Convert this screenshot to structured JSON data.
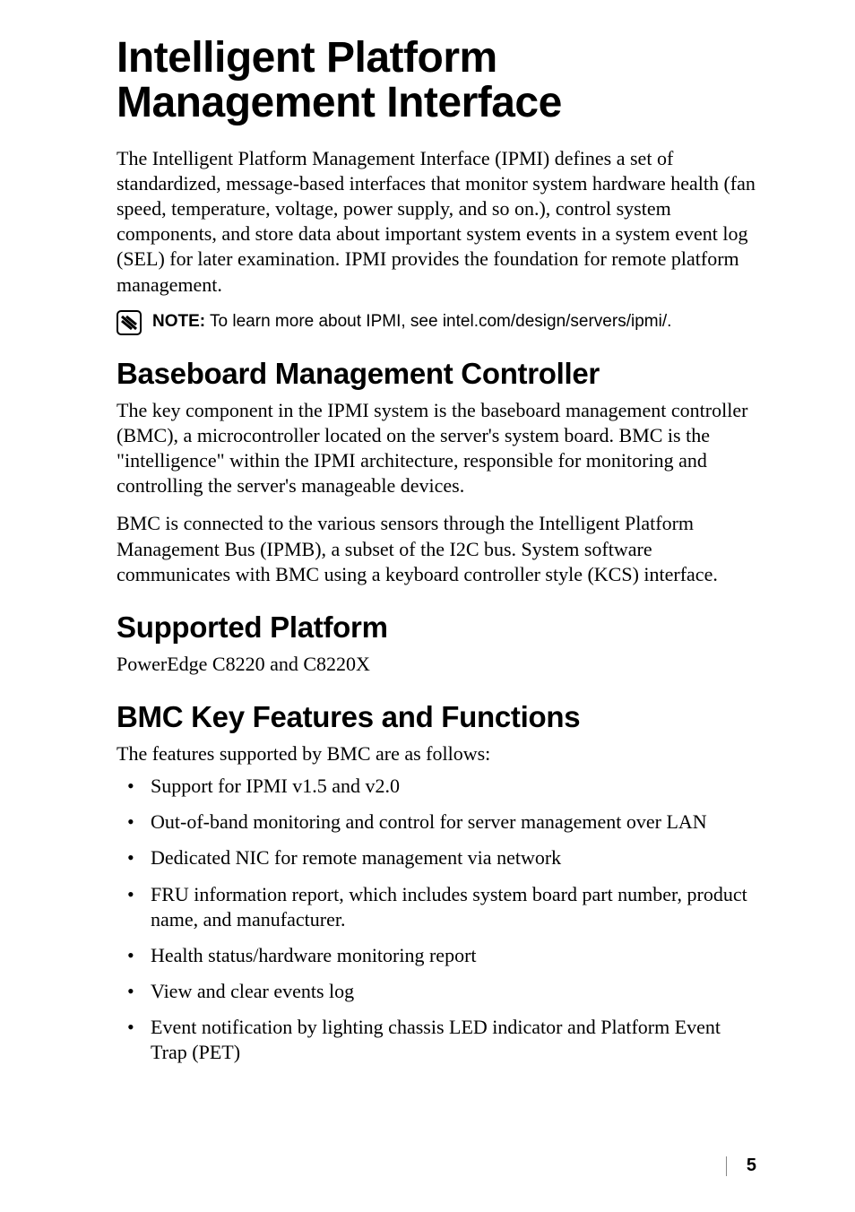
{
  "chapter_title": "Intelligent Platform Management Interface",
  "intro_para": "The Intelligent Platform Management Interface (IPMI) defines a set of standardized, message-based interfaces that monitor system hardware health (fan speed, temperature, voltage, power supply, and so on.), control system components, and store data about important system events in a system event log (SEL) for later examination. IPMI provides the foundation for remote platform management.",
  "note": {
    "label": "NOTE:",
    "text": " To learn more about IPMI, see intel.com/design/servers/ipmi/."
  },
  "sections": {
    "bmc": {
      "heading": "Baseboard Management Controller",
      "para1": "The key component in the IPMI system is the baseboard management controller (BMC), a microcontroller located on the server's system board. BMC is the \"intelligence\" within the IPMI architecture, responsible for monitoring and controlling the server's manageable devices.",
      "para2": "BMC is connected to the various sensors through the Intelligent Platform Management Bus (IPMB), a subset of the I2C bus. System software communicates with BMC using a keyboard controller style (KCS) interface."
    },
    "supported": {
      "heading": "Supported Platform",
      "para": "PowerEdge C8220 and C8220X"
    },
    "features": {
      "heading": "BMC Key Features and Functions",
      "intro": "The features supported by BMC are as follows:",
      "items": [
        "Support for IPMI v1.5 and v2.0",
        "Out-of-band monitoring and control for server management over LAN",
        "Dedicated NIC for remote management via network",
        "FRU information report, which includes system board part number, product name, and manufacturer.",
        "Health status/hardware monitoring report",
        "View and clear events log",
        "Event notification by lighting chassis LED indicator and Platform Event Trap (PET)"
      ]
    }
  },
  "page_number": "5"
}
